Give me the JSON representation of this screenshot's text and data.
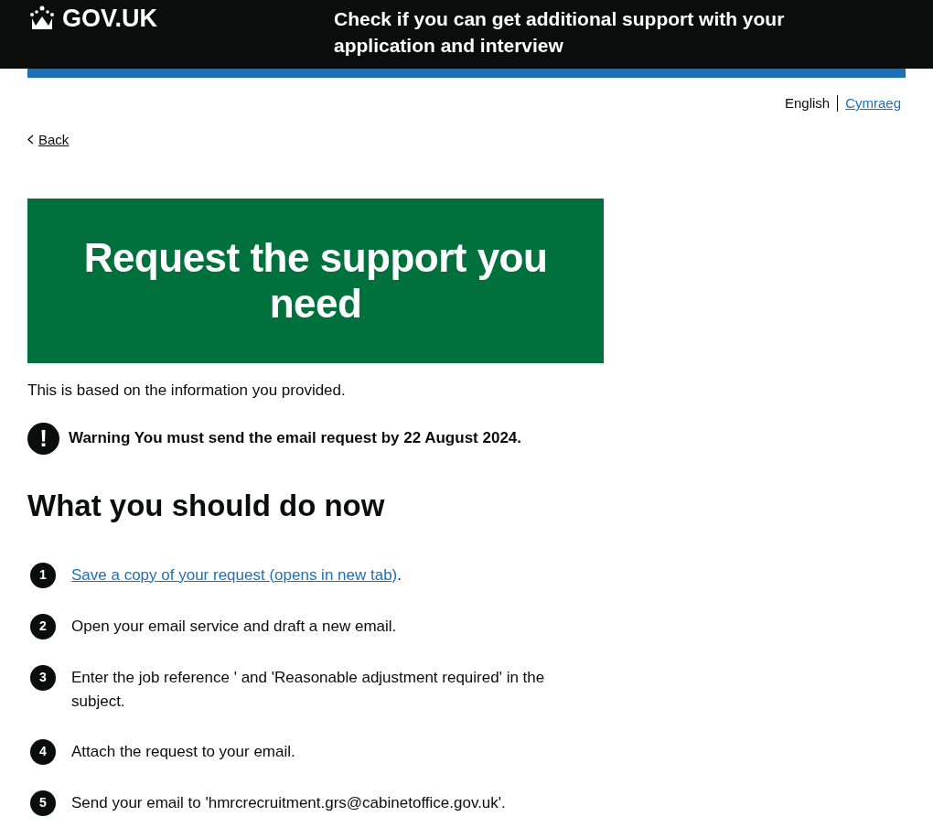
{
  "header": {
    "logo": "GOV.UK",
    "service_name": "Check if you can get additional support with your application and interview"
  },
  "languages": [
    {
      "label": "English",
      "selected": true
    },
    {
      "label": "Cymraeg",
      "selected": false
    }
  ],
  "back_link": "Back",
  "panel": {
    "title": "Request the support you need"
  },
  "intro": "This is based on the information you provided.",
  "warning": {
    "icon": "!",
    "text": "Warning You must send the email request by 22 August 2024."
  },
  "heading": "What you should do now",
  "steps": [
    {
      "number": "1",
      "kind": "link",
      "link": "Save a copy of your request (opens in new tab)",
      "after": "."
    },
    {
      "number": "2",
      "kind": "text",
      "text": "Open your email service and draft a new email."
    },
    {
      "number": "3",
      "kind": "text",
      "text": "Enter the job reference ' and 'Reasonable adjustment required' in the subject."
    },
    {
      "number": "4",
      "kind": "text",
      "text": "Attach the request to your email."
    },
    {
      "number": "5",
      "kind": "text",
      "text": "Send your email to 'hmrcrecruitment.grs@cabinetoffice.gov.uk'."
    }
  ]
}
